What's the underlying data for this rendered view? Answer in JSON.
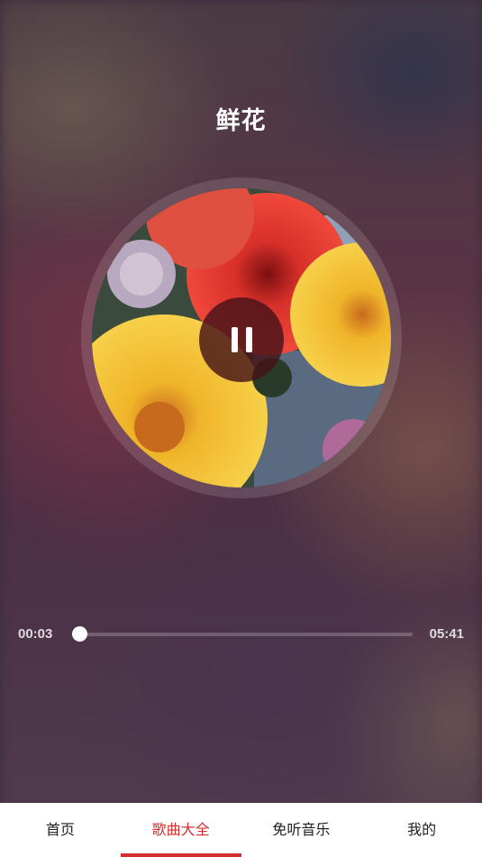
{
  "song": {
    "title": "鲜花"
  },
  "player": {
    "state": "playing",
    "control_icon": "pause-icon",
    "current_time": "00:03",
    "total_time": "05:41",
    "progress": 0.02
  },
  "tabs": [
    {
      "label": "首页",
      "active": false
    },
    {
      "label": "歌曲大全",
      "active": true
    },
    {
      "label": "免听音乐",
      "active": false
    },
    {
      "label": "我的",
      "active": false
    }
  ],
  "colors": {
    "accent": "#d32f2f"
  }
}
